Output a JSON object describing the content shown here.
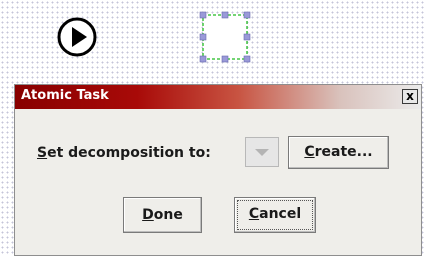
{
  "dialog": {
    "title": "Atomic Task",
    "close_glyph": "x",
    "decomp_label_first": "S",
    "decomp_label_rest": "et decomposition to:",
    "create_first": "C",
    "create_rest": "reate...",
    "done_first": "D",
    "done_rest": "one",
    "cancel_first": "C",
    "cancel_rest": "ancel"
  },
  "canvas": {
    "icons": [
      "play-icon",
      "task-node"
    ]
  },
  "colors": {
    "titlebar_start": "#880000",
    "selection_dashes": "#22bb22",
    "handles": "#9a9ad8",
    "dialog_bg": "#efeeea"
  }
}
